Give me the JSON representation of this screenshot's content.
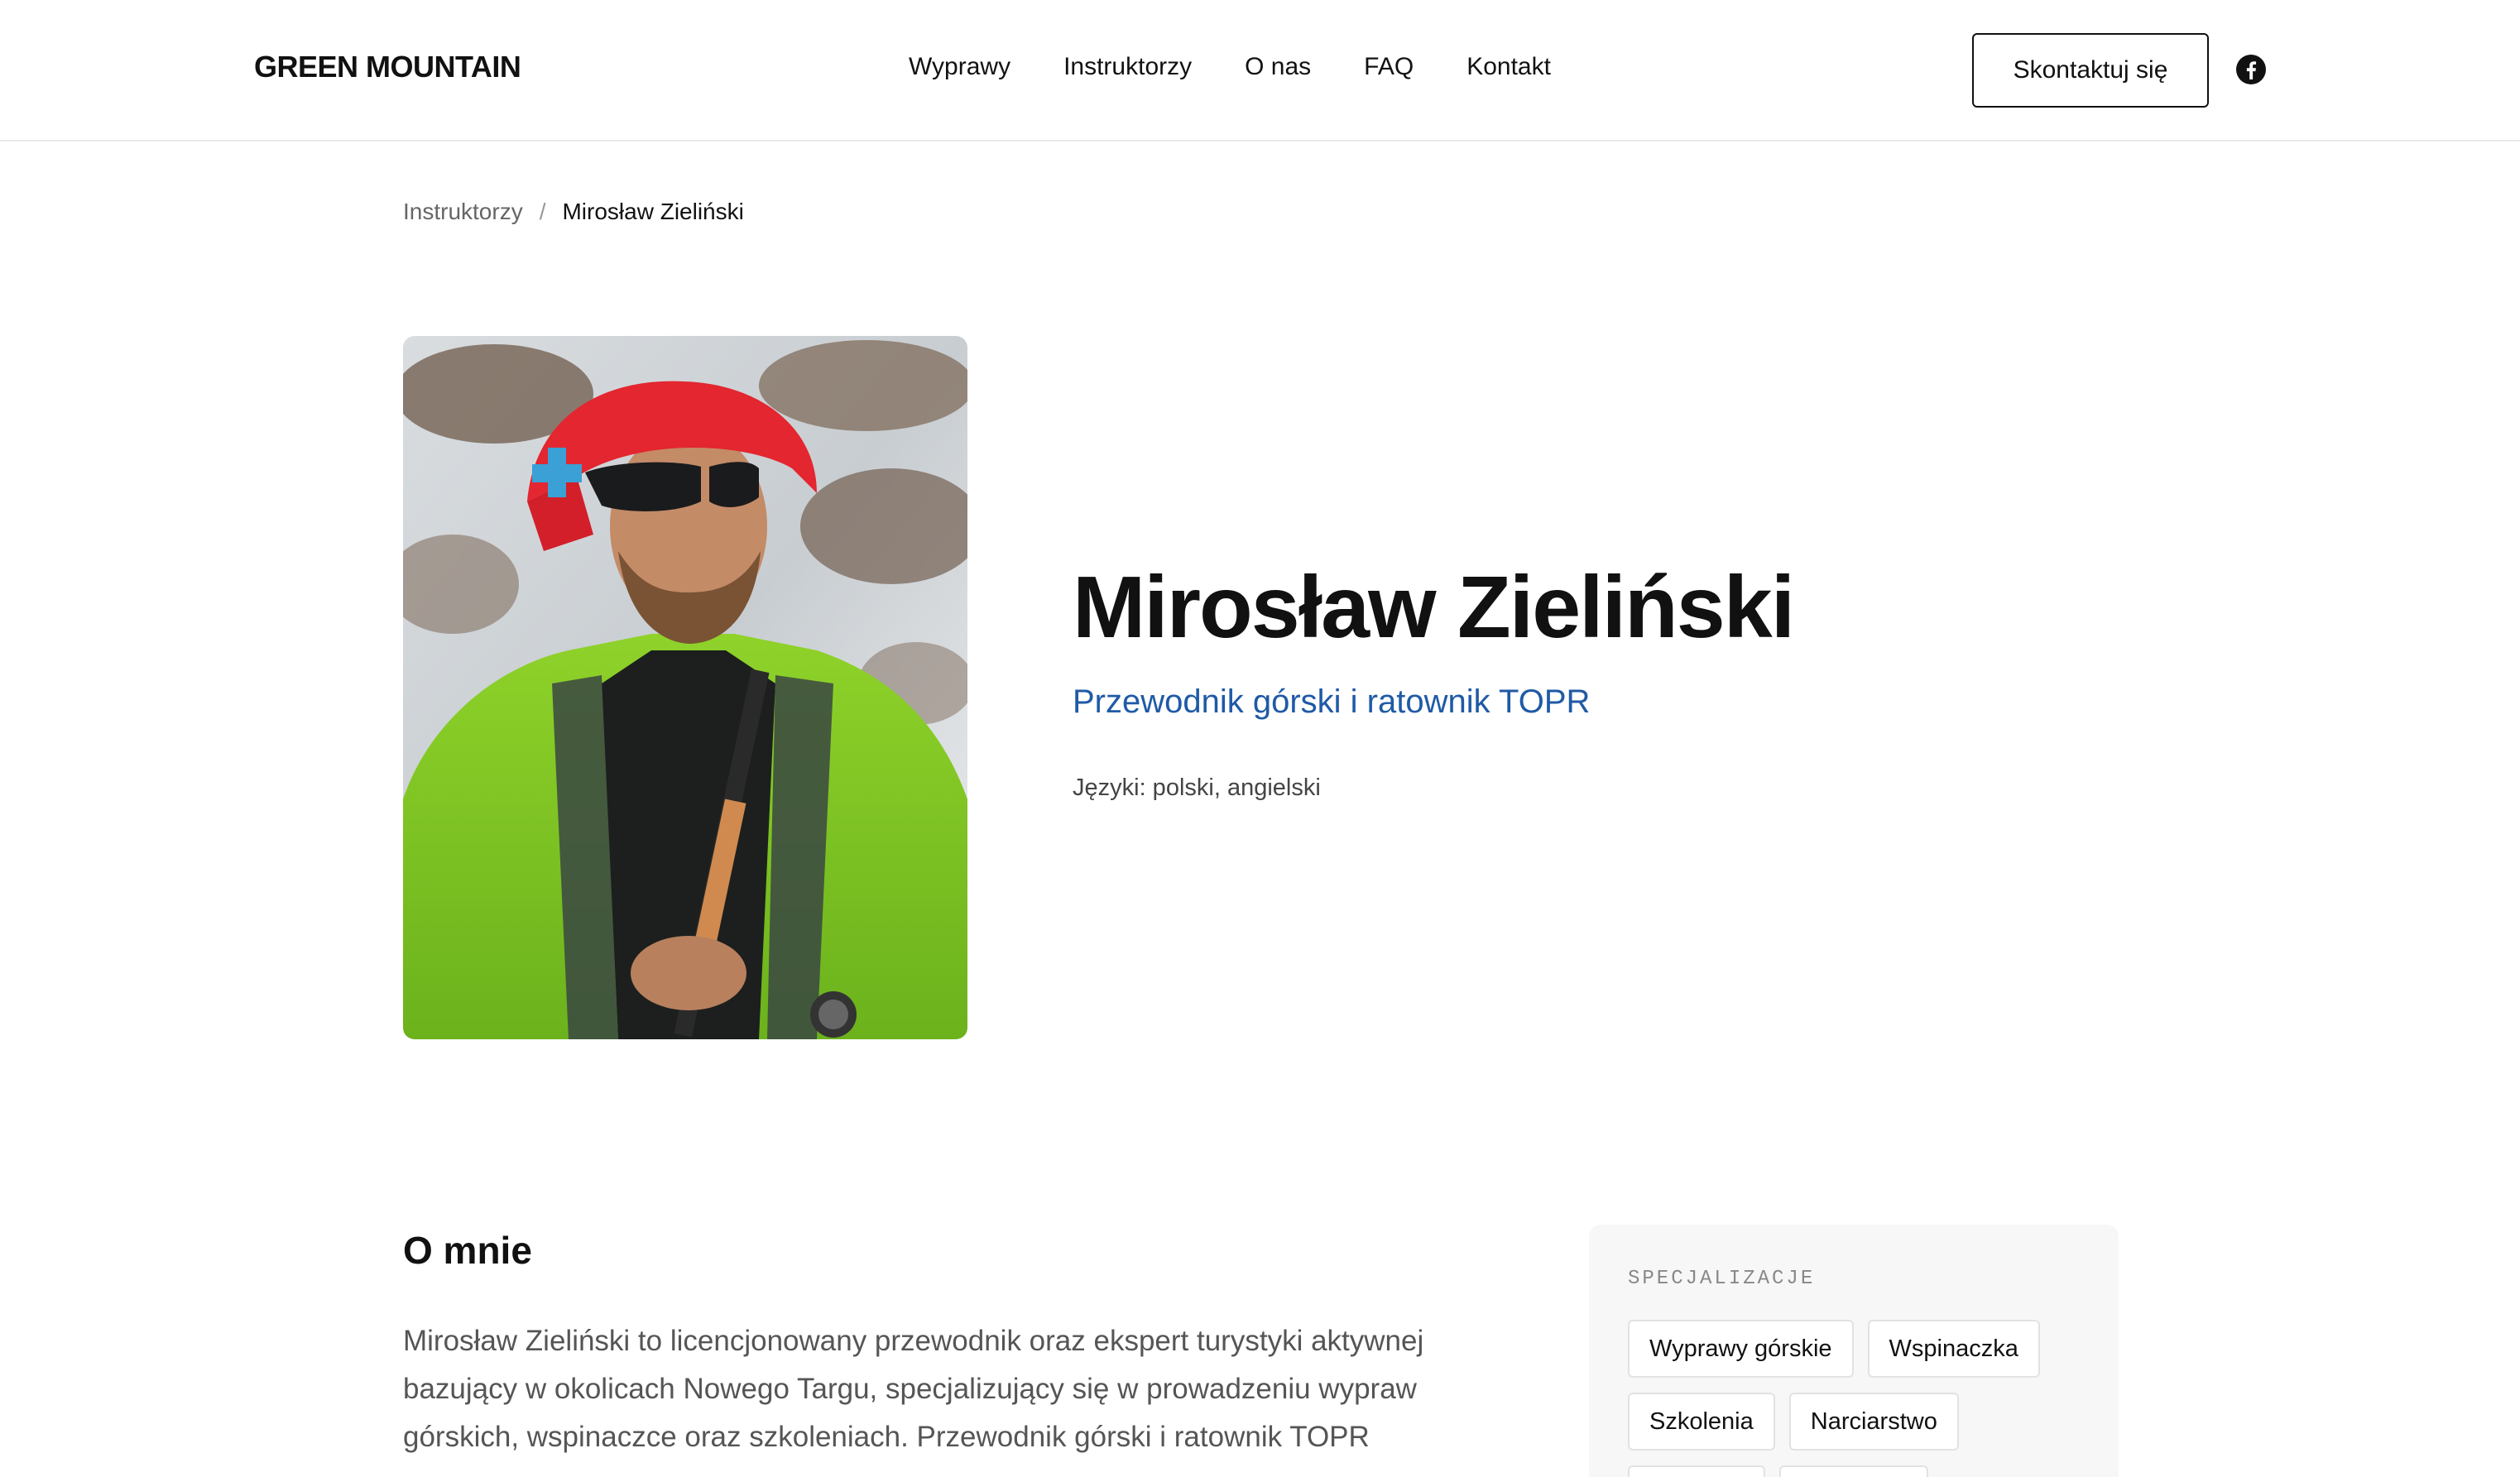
{
  "header": {
    "logo": "GREEN MOUNTAIN",
    "nav": [
      {
        "label": "Wyprawy"
      },
      {
        "label": "Instruktorzy"
      },
      {
        "label": "O nas"
      },
      {
        "label": "FAQ"
      },
      {
        "label": "Kontakt"
      }
    ],
    "cta_label": "Skontaktuj się",
    "social_icon": "facebook-icon"
  },
  "breadcrumb": {
    "parent": "Instruktorzy",
    "separator": "/",
    "current": "Mirosław Zieliński"
  },
  "profile": {
    "name": "Mirosław Zieliński",
    "role": "Przewodnik górski i ratownik TOPR",
    "languages": "Języki: polski, angielski",
    "role_color": "#1f5aa6"
  },
  "about": {
    "title": "O mnie",
    "lines": [
      "Mirosław Zieliński to licencjonowany przewodnik oraz ekspert turystyki aktywnej",
      "bazujący w okolicach Nowego Targu, specjalizujący się w prowadzeniu wypraw",
      "górskich, wspinaczce oraz szkoleniach. Przewodnik górski i ratownik TOPR"
    ]
  },
  "specializations": {
    "heading": "SPECJALIZACJE",
    "tags": [
      "Wyprawy górskie",
      "Wspinaczka",
      "Szkolenia",
      "Narciarstwo"
    ]
  }
}
